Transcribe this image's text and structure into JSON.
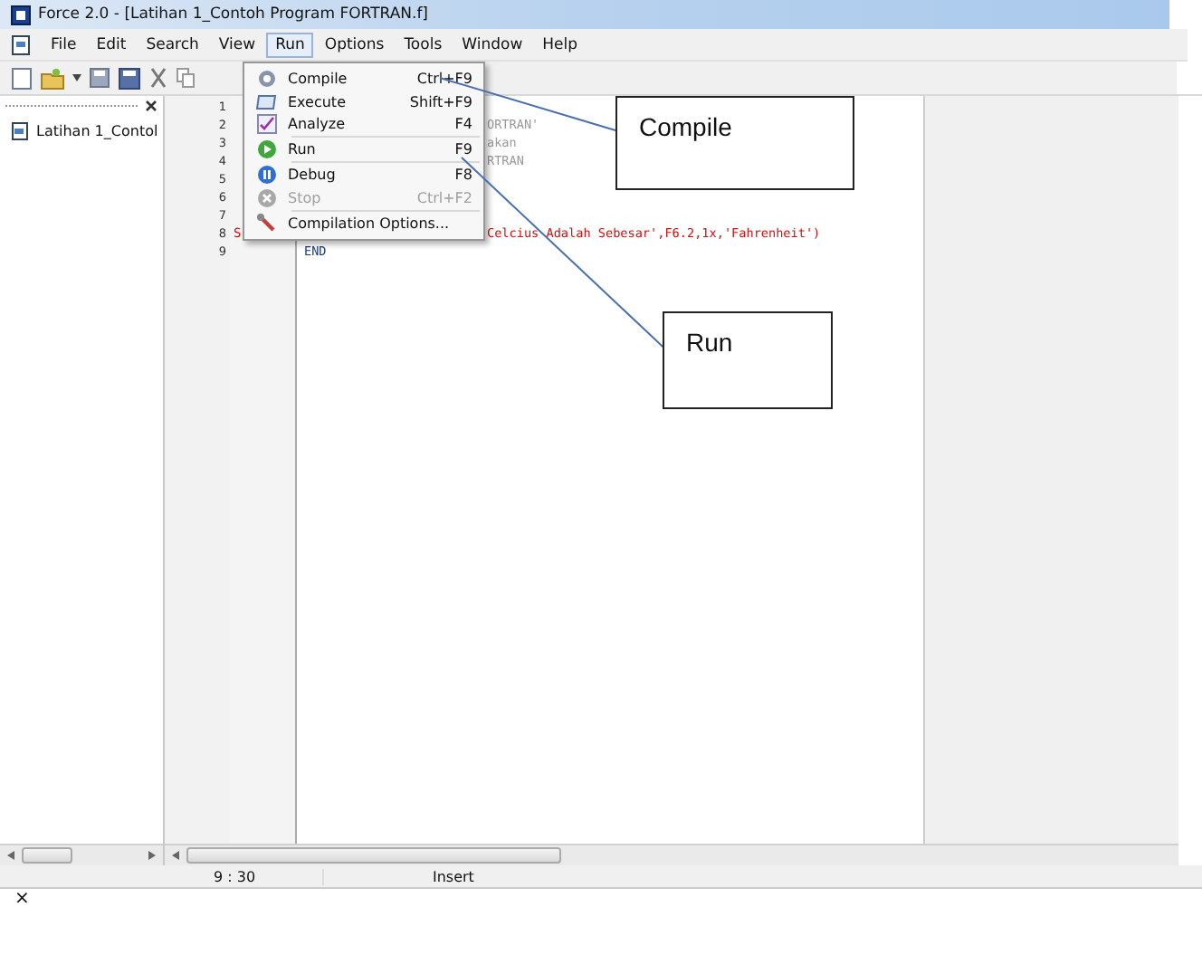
{
  "window": {
    "title": "Force 2.0 - [Latihan 1_Contoh Program FORTRAN.f]"
  },
  "menu_bar": [
    {
      "label": "File",
      "selected": false
    },
    {
      "label": "Edit",
      "selected": false
    },
    {
      "label": "Search",
      "selected": false
    },
    {
      "label": "View",
      "selected": false
    },
    {
      "label": "Run",
      "selected": true
    },
    {
      "label": "Options",
      "selected": false
    },
    {
      "label": "Tools",
      "selected": false
    },
    {
      "label": "Window",
      "selected": false
    },
    {
      "label": "Help",
      "selected": false
    }
  ],
  "side_panel": {
    "items": [
      {
        "label": "Latihan 1_Contol"
      }
    ]
  },
  "editor": {
    "lines": [
      {
        "number": "1",
        "kind": "blank"
      },
      {
        "number": "2",
        "kind": "comment",
        "text": "ORTRAN'"
      },
      {
        "number": "3",
        "kind": "comment",
        "text": "akan"
      },
      {
        "number": "4",
        "kind": "comment",
        "text": "RTRAN"
      },
      {
        "number": "5",
        "kind": "blank"
      },
      {
        "number": "6",
        "kind": "blank"
      },
      {
        "number": "7",
        "kind": "blank"
      },
      {
        "number": "8",
        "kind": "string",
        "mark": "S",
        "text": "Celcius Adalah Sebesar',F6.2,1x,'Fahrenheit')"
      },
      {
        "number": "9",
        "kind": "keyword",
        "text": "END"
      }
    ]
  },
  "run_menu": [
    {
      "label": "Compile",
      "shortcut": "Ctrl+F9",
      "disabled": false,
      "separator_after": false
    },
    {
      "label": "Execute",
      "shortcut": "Shift+F9",
      "disabled": false,
      "separator_after": false
    },
    {
      "label": "Analyze",
      "shortcut": "F4",
      "disabled": false,
      "separator_after": true
    },
    {
      "label": "Run",
      "shortcut": "F9",
      "disabled": false,
      "separator_after": true
    },
    {
      "label": "Debug",
      "shortcut": "F8",
      "disabled": false,
      "separator_after": false
    },
    {
      "label": "Stop",
      "shortcut": "Ctrl+F2",
      "disabled": true,
      "separator_after": true
    },
    {
      "label": "Compilation Options...",
      "disabled": false,
      "separator_after": false
    }
  ],
  "callouts": [
    {
      "text": "Compile"
    },
    {
      "text": "Run"
    }
  ],
  "status_bar": {
    "position": "9 : 30",
    "mode": "Insert"
  },
  "bottom_panel": {
    "close": "×"
  }
}
